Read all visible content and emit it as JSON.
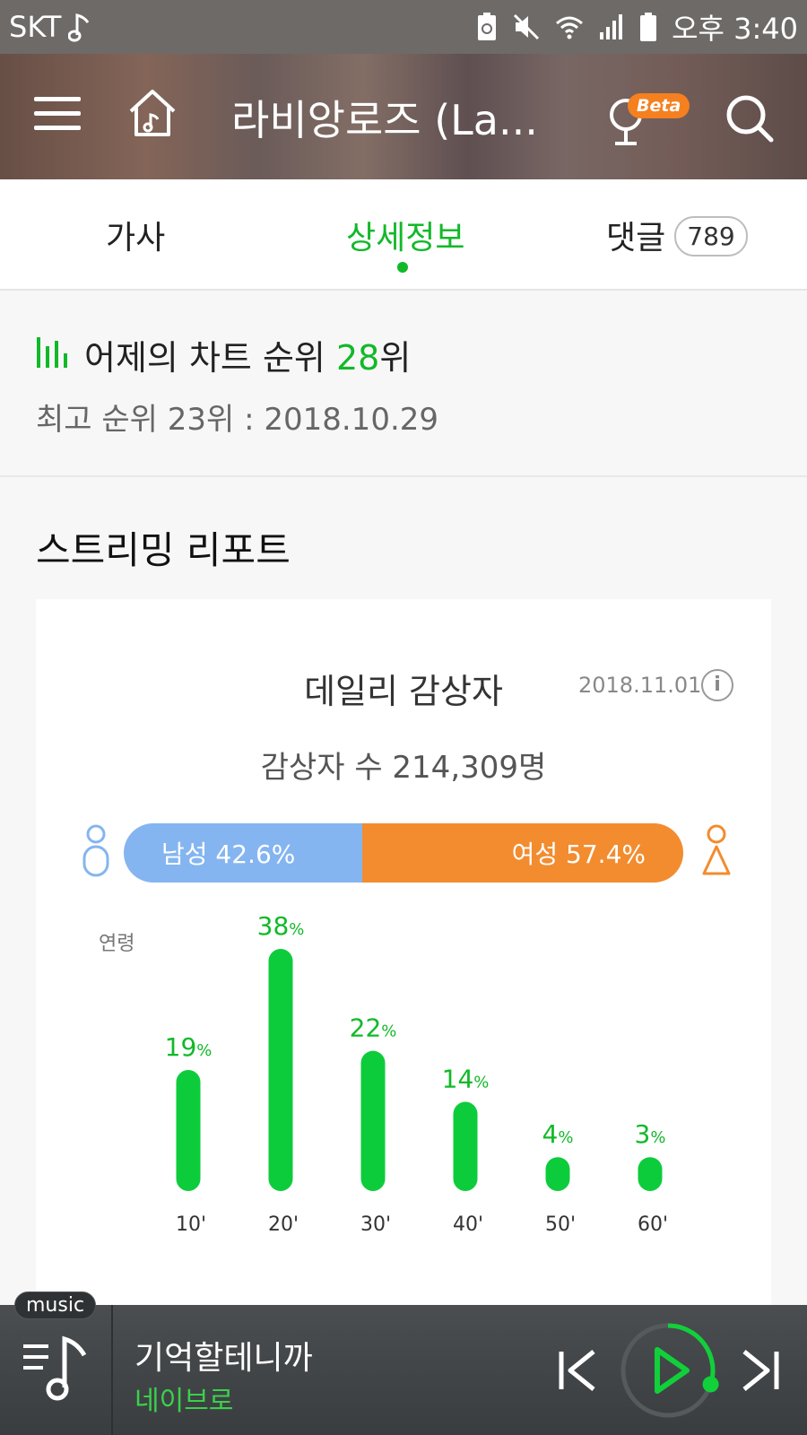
{
  "status_bar": {
    "carrier": "SKT",
    "time": "오후 3:40",
    "icons": [
      "music-note-icon",
      "battery-saver-icon",
      "mute-icon",
      "wifi-icon",
      "signal-icon",
      "battery-icon"
    ]
  },
  "header": {
    "title": "라비앙로즈 (La...",
    "beta_label": "Beta",
    "icons": [
      "menu-icon",
      "home-icon",
      "mic-icon",
      "search-icon"
    ]
  },
  "tabs": {
    "items": [
      {
        "label": "가사",
        "active": false
      },
      {
        "label": "상세정보",
        "active": true
      },
      {
        "label": "댓글",
        "active": false,
        "count": "789"
      }
    ]
  },
  "chart_rank": {
    "label": "어제의 차트 순위",
    "rank": "28",
    "rank_suffix": "위",
    "best": "최고 순위 23위 : 2018.10.29"
  },
  "report": {
    "section_title": "스트리밍 리포트",
    "card_title": "데일리 감상자",
    "date": "2018.11.01",
    "listeners": "감상자 수 214,309명",
    "male_label": "남성 42.6%",
    "female_label": "여성 57.4%",
    "male_share": 42.6,
    "female_share": 57.4,
    "male_color": "#84b5f0",
    "female_color": "#f28c2f",
    "accent_color": "#11b928"
  },
  "chart_data": {
    "type": "bar",
    "xlabel": "연령",
    "categories": [
      "10'",
      "20'",
      "30'",
      "40'",
      "50'",
      "60'"
    ],
    "values": [
      19,
      38,
      22,
      14,
      4,
      3
    ],
    "unit": "%",
    "ylim": [
      0,
      38
    ]
  },
  "player": {
    "tag": "music",
    "song_title": "기억할테니까",
    "artist": "네이브로",
    "progress": 0.3
  }
}
